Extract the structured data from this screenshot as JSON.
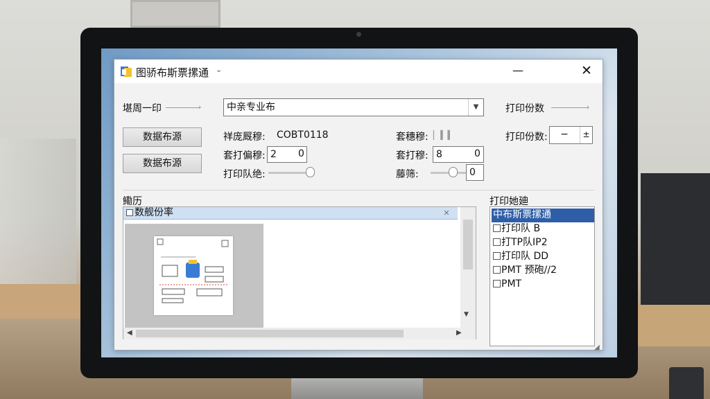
{
  "window": {
    "title": "图骄布斯票摞通",
    "title_caret": "⌄",
    "minimize": "—",
    "close": "✕"
  },
  "left_panel": {
    "heading": "堪周一印",
    "button1": "数据布源",
    "button2": "数据布源"
  },
  "printer_combo": {
    "value": "中亲专业布",
    "arrow": "▼"
  },
  "settings": {
    "label1": "祥庞厩穆:",
    "label1_value": "COBT0118",
    "label2": "套打偏穆:",
    "label2_value": "2",
    "label2_end": "0",
    "label3": "打印队绝:",
    "label4": "套穗穆:",
    "label5": "套打穆:",
    "label5_value": "8",
    "label5_end": "0",
    "label6": "藤筛:",
    "label6_end": "0"
  },
  "copies": {
    "heading": "打印份数",
    "label": "打印份数:",
    "minus": "−",
    "plus": "±"
  },
  "preview": {
    "heading": "鰳历",
    "doc_tab": "数舰份率",
    "doc_tab_close": "✕"
  },
  "printer_list": {
    "heading": "打印她廸",
    "items": [
      {
        "label": "中布斯票摞通",
        "selected": true
      },
      {
        "label": "打印队 B",
        "selected": false
      },
      {
        "label": "打TP队IP2",
        "selected": false
      },
      {
        "label": "打印队 DD",
        "selected": false
      },
      {
        "label": "PMT 预砲//2",
        "selected": false
      },
      {
        "label": "PMT",
        "selected": false
      }
    ]
  },
  "colors": {
    "selection": "#2f5ea8",
    "tab": "#cfe0f3",
    "accent_blue": "#3a7bd5"
  }
}
